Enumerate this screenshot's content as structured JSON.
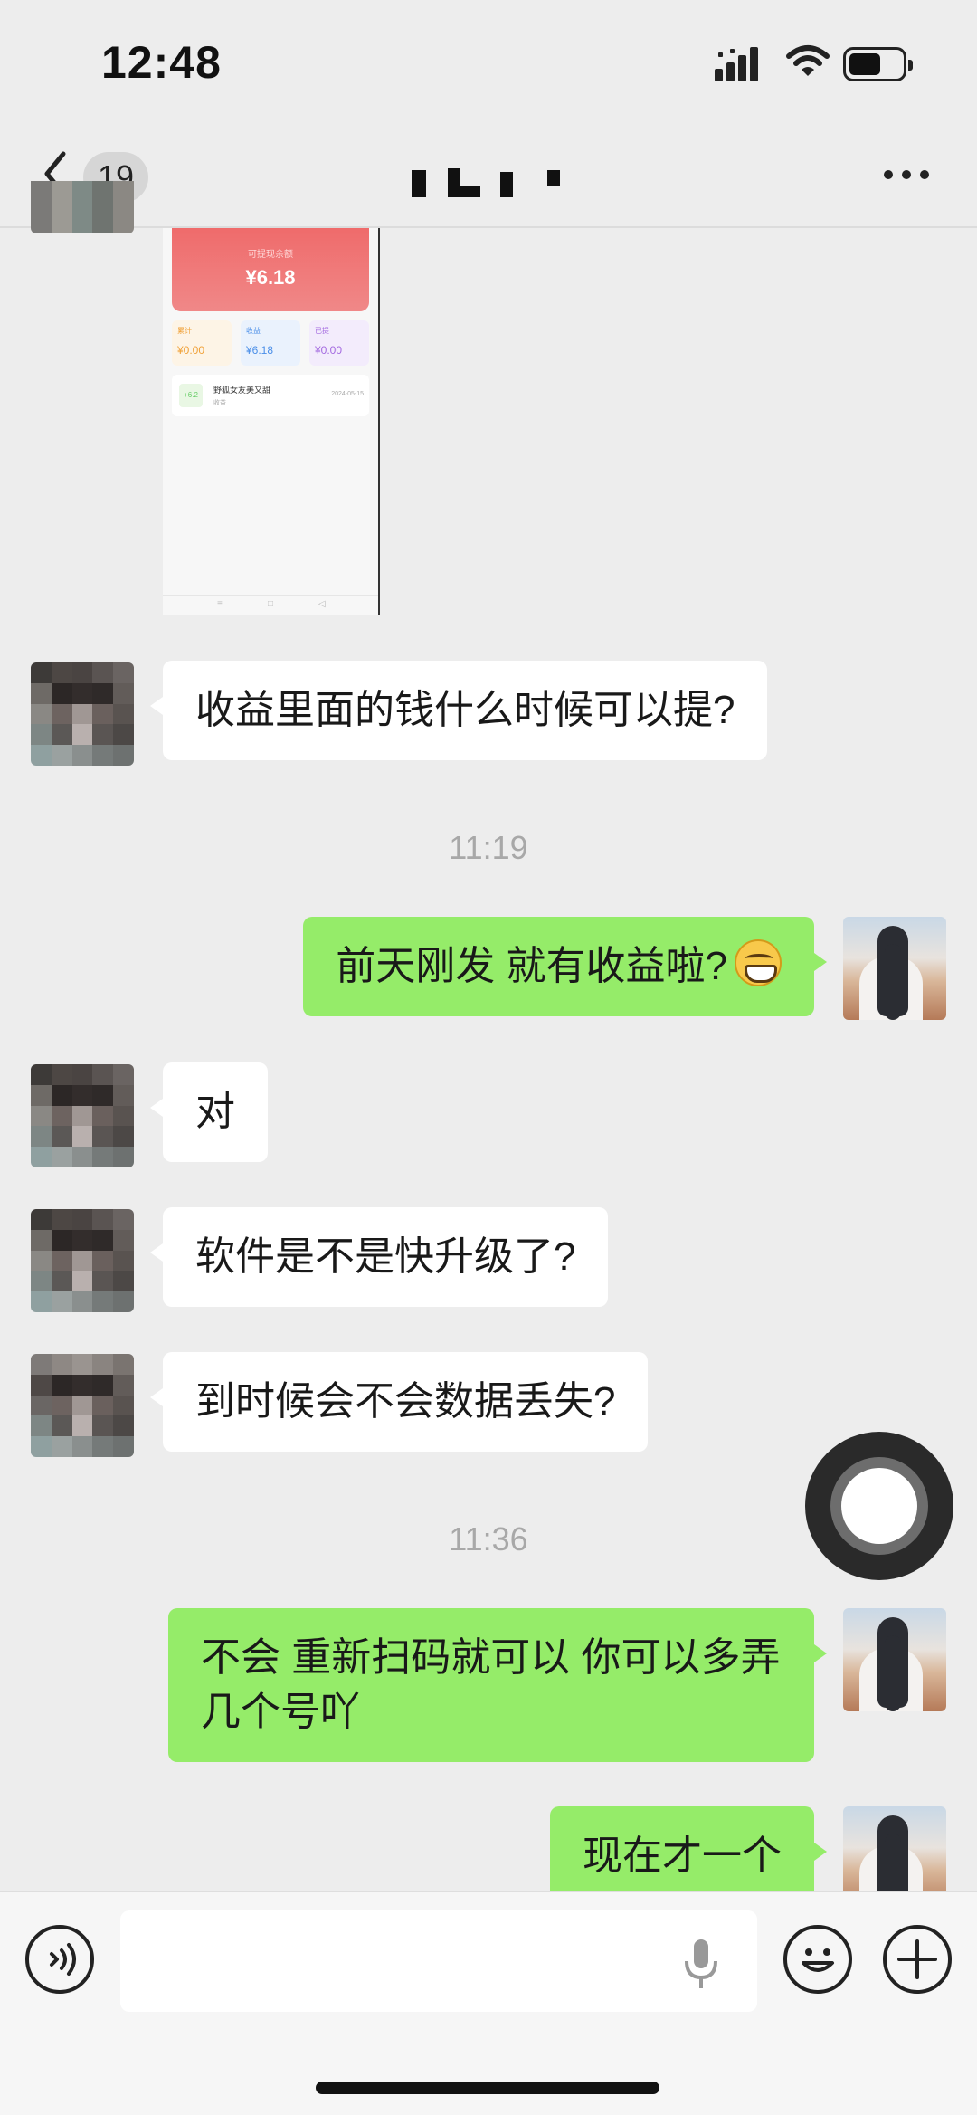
{
  "status_bar": {
    "time": "12:48"
  },
  "nav": {
    "unread_count": "19"
  },
  "shared_screenshot": {
    "card_caption": "可提现余额",
    "balance": "¥6.18",
    "stats": [
      {
        "label": "累计",
        "value": "¥0.00",
        "color": "#f0a23a",
        "bg": "#fdf4e6"
      },
      {
        "label": "收益",
        "value": "¥6.18",
        "color": "#4a8ee8",
        "bg": "#eaf2fd"
      },
      {
        "label": "已提",
        "value": "¥0.00",
        "color": "#a46ae0",
        "bg": "#f3ecfc"
      }
    ],
    "record": {
      "amount": "+6.2",
      "title": "野狐女友美又甜",
      "sub": "收益",
      "date": "2024-05-15"
    }
  },
  "messages": [
    {
      "side": "in",
      "text": "收益里面的钱什么时候可以提?"
    },
    {
      "type": "time",
      "text": "11:19"
    },
    {
      "side": "out",
      "text": "前天刚发 就有收益啦?"
    },
    {
      "side": "in",
      "text": "对"
    },
    {
      "side": "in",
      "text": "软件是不是快升级了?"
    },
    {
      "side": "in",
      "text": "到时候会不会数据丢失?"
    },
    {
      "type": "time",
      "text": "11:36"
    },
    {
      "side": "out",
      "text": "不会 重新扫码就可以 你可以多弄几个号吖"
    },
    {
      "side": "out",
      "text": "现在才一个"
    }
  ],
  "colors": {
    "background": "#ededed",
    "outgoing_bubble": "#95ec69",
    "incoming_bubble": "#ffffff"
  }
}
